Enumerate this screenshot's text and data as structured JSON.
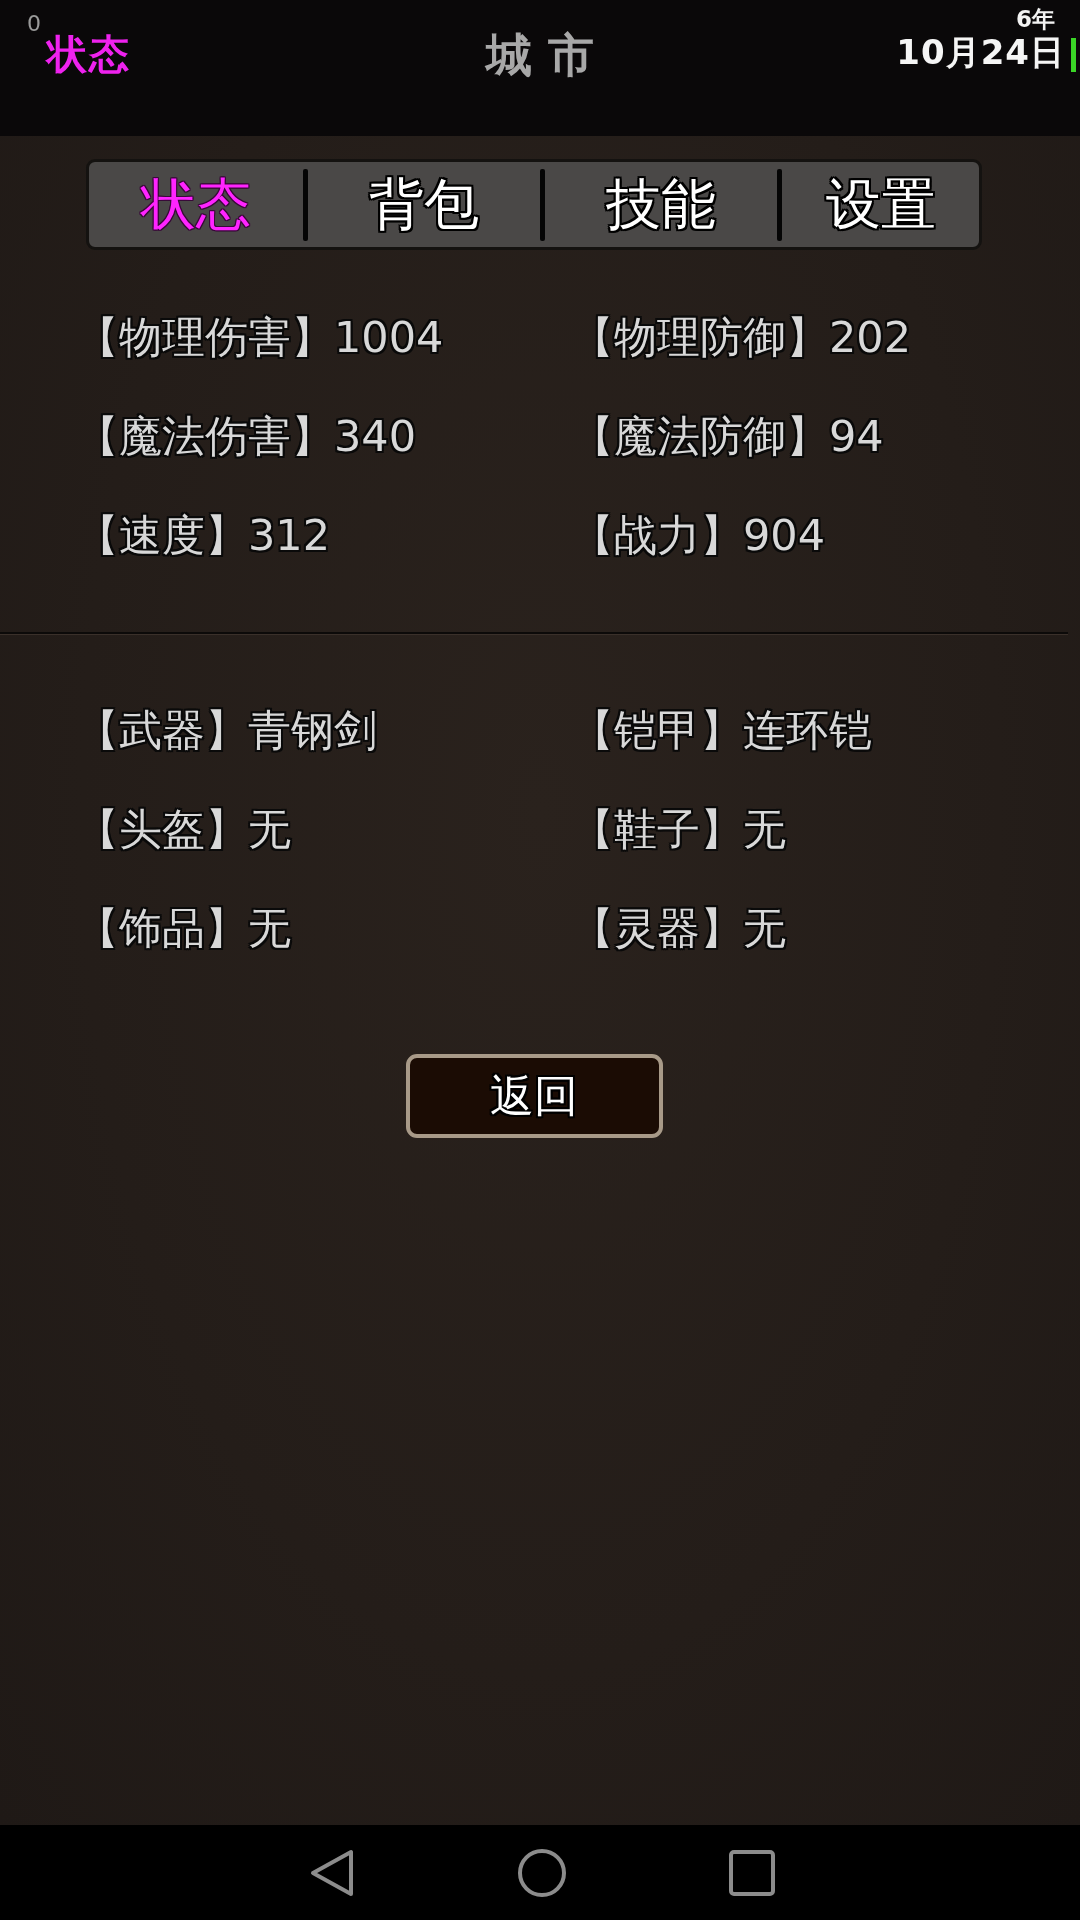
{
  "status_bar": {
    "counter": "0",
    "screen": "状态",
    "location": "城 市",
    "year": "6年",
    "date": "10月24日"
  },
  "tabs": [
    {
      "label": "状态",
      "selected": true
    },
    {
      "label": "背包",
      "selected": false
    },
    {
      "label": "技能",
      "selected": false
    },
    {
      "label": "设置",
      "selected": false
    }
  ],
  "stats": [
    {
      "label": "【物理伤害】",
      "value": "1004"
    },
    {
      "label": "【物理防御】",
      "value": "202"
    },
    {
      "label": "【魔法伤害】",
      "value": "340"
    },
    {
      "label": "【魔法防御】",
      "value": "94"
    },
    {
      "label": "【速度】",
      "value": "312"
    },
    {
      "label": "【战力】",
      "value": "904"
    }
  ],
  "equipment": [
    {
      "label": "【武器】",
      "value": "青钢剑"
    },
    {
      "label": "【铠甲】",
      "value": "连环铠"
    },
    {
      "label": "【头盔】",
      "value": "无"
    },
    {
      "label": "【鞋子】",
      "value": "无"
    },
    {
      "label": "【饰品】",
      "value": "无"
    },
    {
      "label": "【灵器】",
      "value": "无"
    }
  ],
  "back_button": {
    "label": "返回"
  }
}
